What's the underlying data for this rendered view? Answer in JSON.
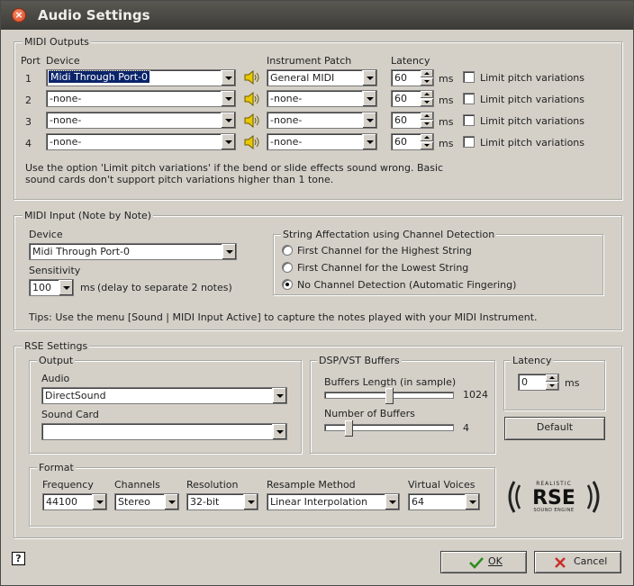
{
  "window": {
    "title": "Audio Settings"
  },
  "midi_outputs": {
    "legend": "MIDI Outputs",
    "headers": {
      "port": "Port",
      "device": "Device",
      "instrument_patch": "Instrument Patch",
      "latency": "Latency"
    },
    "rows": [
      {
        "port": "1",
        "device": "Midi Through Port-0",
        "patch": "General MIDI",
        "latency": "60",
        "unit": "ms",
        "limit_label": "Limit pitch variations",
        "limit_checked": false
      },
      {
        "port": "2",
        "device": "-none-",
        "patch": "-none-",
        "latency": "60",
        "unit": "ms",
        "limit_label": "Limit pitch variations",
        "limit_checked": false
      },
      {
        "port": "3",
        "device": "-none-",
        "patch": "-none-",
        "latency": "60",
        "unit": "ms",
        "limit_label": "Limit pitch variations",
        "limit_checked": false
      },
      {
        "port": "4",
        "device": "-none-",
        "patch": "-none-",
        "latency": "60",
        "unit": "ms",
        "limit_label": "Limit pitch variations",
        "limit_checked": false
      }
    ],
    "note_line1": "Use the option 'Limit pitch variations' if the bend or slide effects sound wrong. Basic",
    "note_line2": "sound cards don't support pitch variations higher than 1 tone."
  },
  "midi_input": {
    "legend": "MIDI Input (Note by Note)",
    "device_label": "Device",
    "device_value": "Midi Through Port-0",
    "sensitivity_label": "Sensitivity",
    "sensitivity_value": "100",
    "sensitivity_unit": "ms",
    "sensitivity_hint": "(delay to separate 2 notes)",
    "string_group": {
      "legend": "String Affectation using Channel Detection",
      "options": [
        {
          "label": "First Channel for the Highest String",
          "selected": false
        },
        {
          "label": "First Channel for the Lowest String",
          "selected": false
        },
        {
          "label": "No Channel Detection (Automatic Fingering)",
          "selected": true
        }
      ]
    },
    "tips": "Tips: Use the menu [Sound | MIDI Input Active] to capture the notes played with your MIDI Instrument."
  },
  "rse": {
    "legend": "RSE Settings",
    "output": {
      "legend": "Output",
      "audio_label": "Audio",
      "audio_value": "DirectSound",
      "sound_card_label": "Sound Card",
      "sound_card_value": ""
    },
    "dsp": {
      "legend": "DSP/VST Buffers",
      "buffers_length_label": "Buffers Length (in sample)",
      "buffers_length_value": "1024",
      "buffers_length_fraction": 0.5,
      "number_of_buffers_label": "Number of Buffers",
      "number_of_buffers_value": "4",
      "number_of_buffers_fraction": 0.17
    },
    "latency": {
      "legend": "Latency",
      "value": "0",
      "unit": "ms"
    },
    "default_button": "Default",
    "format": {
      "legend": "Format",
      "frequency_label": "Frequency",
      "frequency_value": "44100",
      "channels_label": "Channels",
      "channels_value": "Stereo",
      "resolution_label": "Resolution",
      "resolution_value": "32-bit",
      "resample_label": "Resample Method",
      "resample_value": "Linear Interpolation",
      "voices_label": "Virtual Voices",
      "voices_value": "64"
    },
    "logo": {
      "top": "REALISTIC",
      "main": "RSE",
      "bottom": "SOUND ENGINE"
    }
  },
  "footer": {
    "help_icon": "?",
    "ok_label": "OK",
    "cancel_label": "Cancel"
  },
  "icons": {
    "close": "close-icon",
    "speaker": "speaker-icon",
    "ok": "checkmark-icon",
    "cancel": "x-icon",
    "help": "help-icon"
  },
  "colors": {
    "selection": "#0a246a",
    "title_bar": "#3c3b37",
    "close": "#d9461f",
    "ok_check": "#2f8a1f",
    "cancel_x": "#c8302a"
  }
}
